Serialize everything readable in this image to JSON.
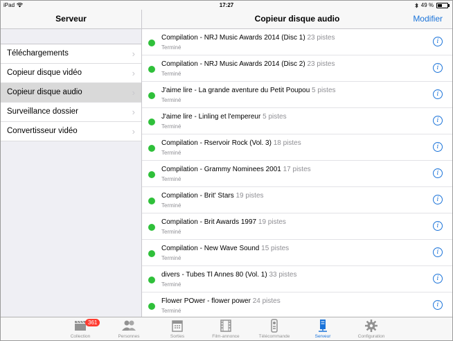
{
  "status": {
    "device": "iPad",
    "time": "17:27",
    "battery": "49 %"
  },
  "master": {
    "title": "Serveur",
    "items": [
      {
        "label": "Téléchargements"
      },
      {
        "label": "Copieur disque vidéo"
      },
      {
        "label": "Copieur disque audio"
      },
      {
        "label": "Surveillance dossier"
      },
      {
        "label": "Convertisseur vidéo"
      }
    ]
  },
  "detail": {
    "title": "Copieur disque audio",
    "edit_label": "Modifier",
    "rows": [
      {
        "title": "Compilation - NRJ Music Awards 2014 (Disc 1)",
        "count": "23 pistes",
        "status": "Terminé"
      },
      {
        "title": "Compilation - NRJ Music Awards 2014 (Disc 2)",
        "count": "23 pistes",
        "status": "Terminé"
      },
      {
        "title": "J'aime lire - La grande aventure du Petit Poupou",
        "count": "5 pistes",
        "status": "Terminé"
      },
      {
        "title": "J'aime lire - Linling et l'empereur",
        "count": "5 pistes",
        "status": "Terminé"
      },
      {
        "title": "Compilation - Rservoir Rock (Vol. 3)",
        "count": "18 pistes",
        "status": "Terminé"
      },
      {
        "title": "Compilation - Grammy Nominees 2001",
        "count": "17 pistes",
        "status": "Terminé"
      },
      {
        "title": "Compilation - Brit' Stars",
        "count": "19 pistes",
        "status": "Terminé"
      },
      {
        "title": "Compilation - Brit Awards 1997",
        "count": "19 pistes",
        "status": "Terminé"
      },
      {
        "title": "Compilation - New Wave Sound",
        "count": "15 pistes",
        "status": "Terminé"
      },
      {
        "title": "divers - Tubes Tl Annes 80 (Vol. 1)",
        "count": "33 pistes",
        "status": "Terminé"
      },
      {
        "title": "Flower POwer - flower power",
        "count": "24 pistes",
        "status": "Terminé"
      }
    ]
  },
  "tabbar": {
    "items": [
      {
        "label": "Collection",
        "icon": "clapperboard-icon",
        "badge": "361"
      },
      {
        "label": "Personnes",
        "icon": "people-icon"
      },
      {
        "label": "Sorties",
        "icon": "calendar-icon"
      },
      {
        "label": "Film-annonce",
        "icon": "film-strip-icon"
      },
      {
        "label": "Télécommande",
        "icon": "remote-icon"
      },
      {
        "label": "Serveur",
        "icon": "server-icon"
      },
      {
        "label": "Configuration",
        "icon": "gear-icon"
      }
    ]
  },
  "colors": {
    "accent": "#1a73d9",
    "status_dot": "#2fc03a",
    "badge": "#ff3b30"
  }
}
